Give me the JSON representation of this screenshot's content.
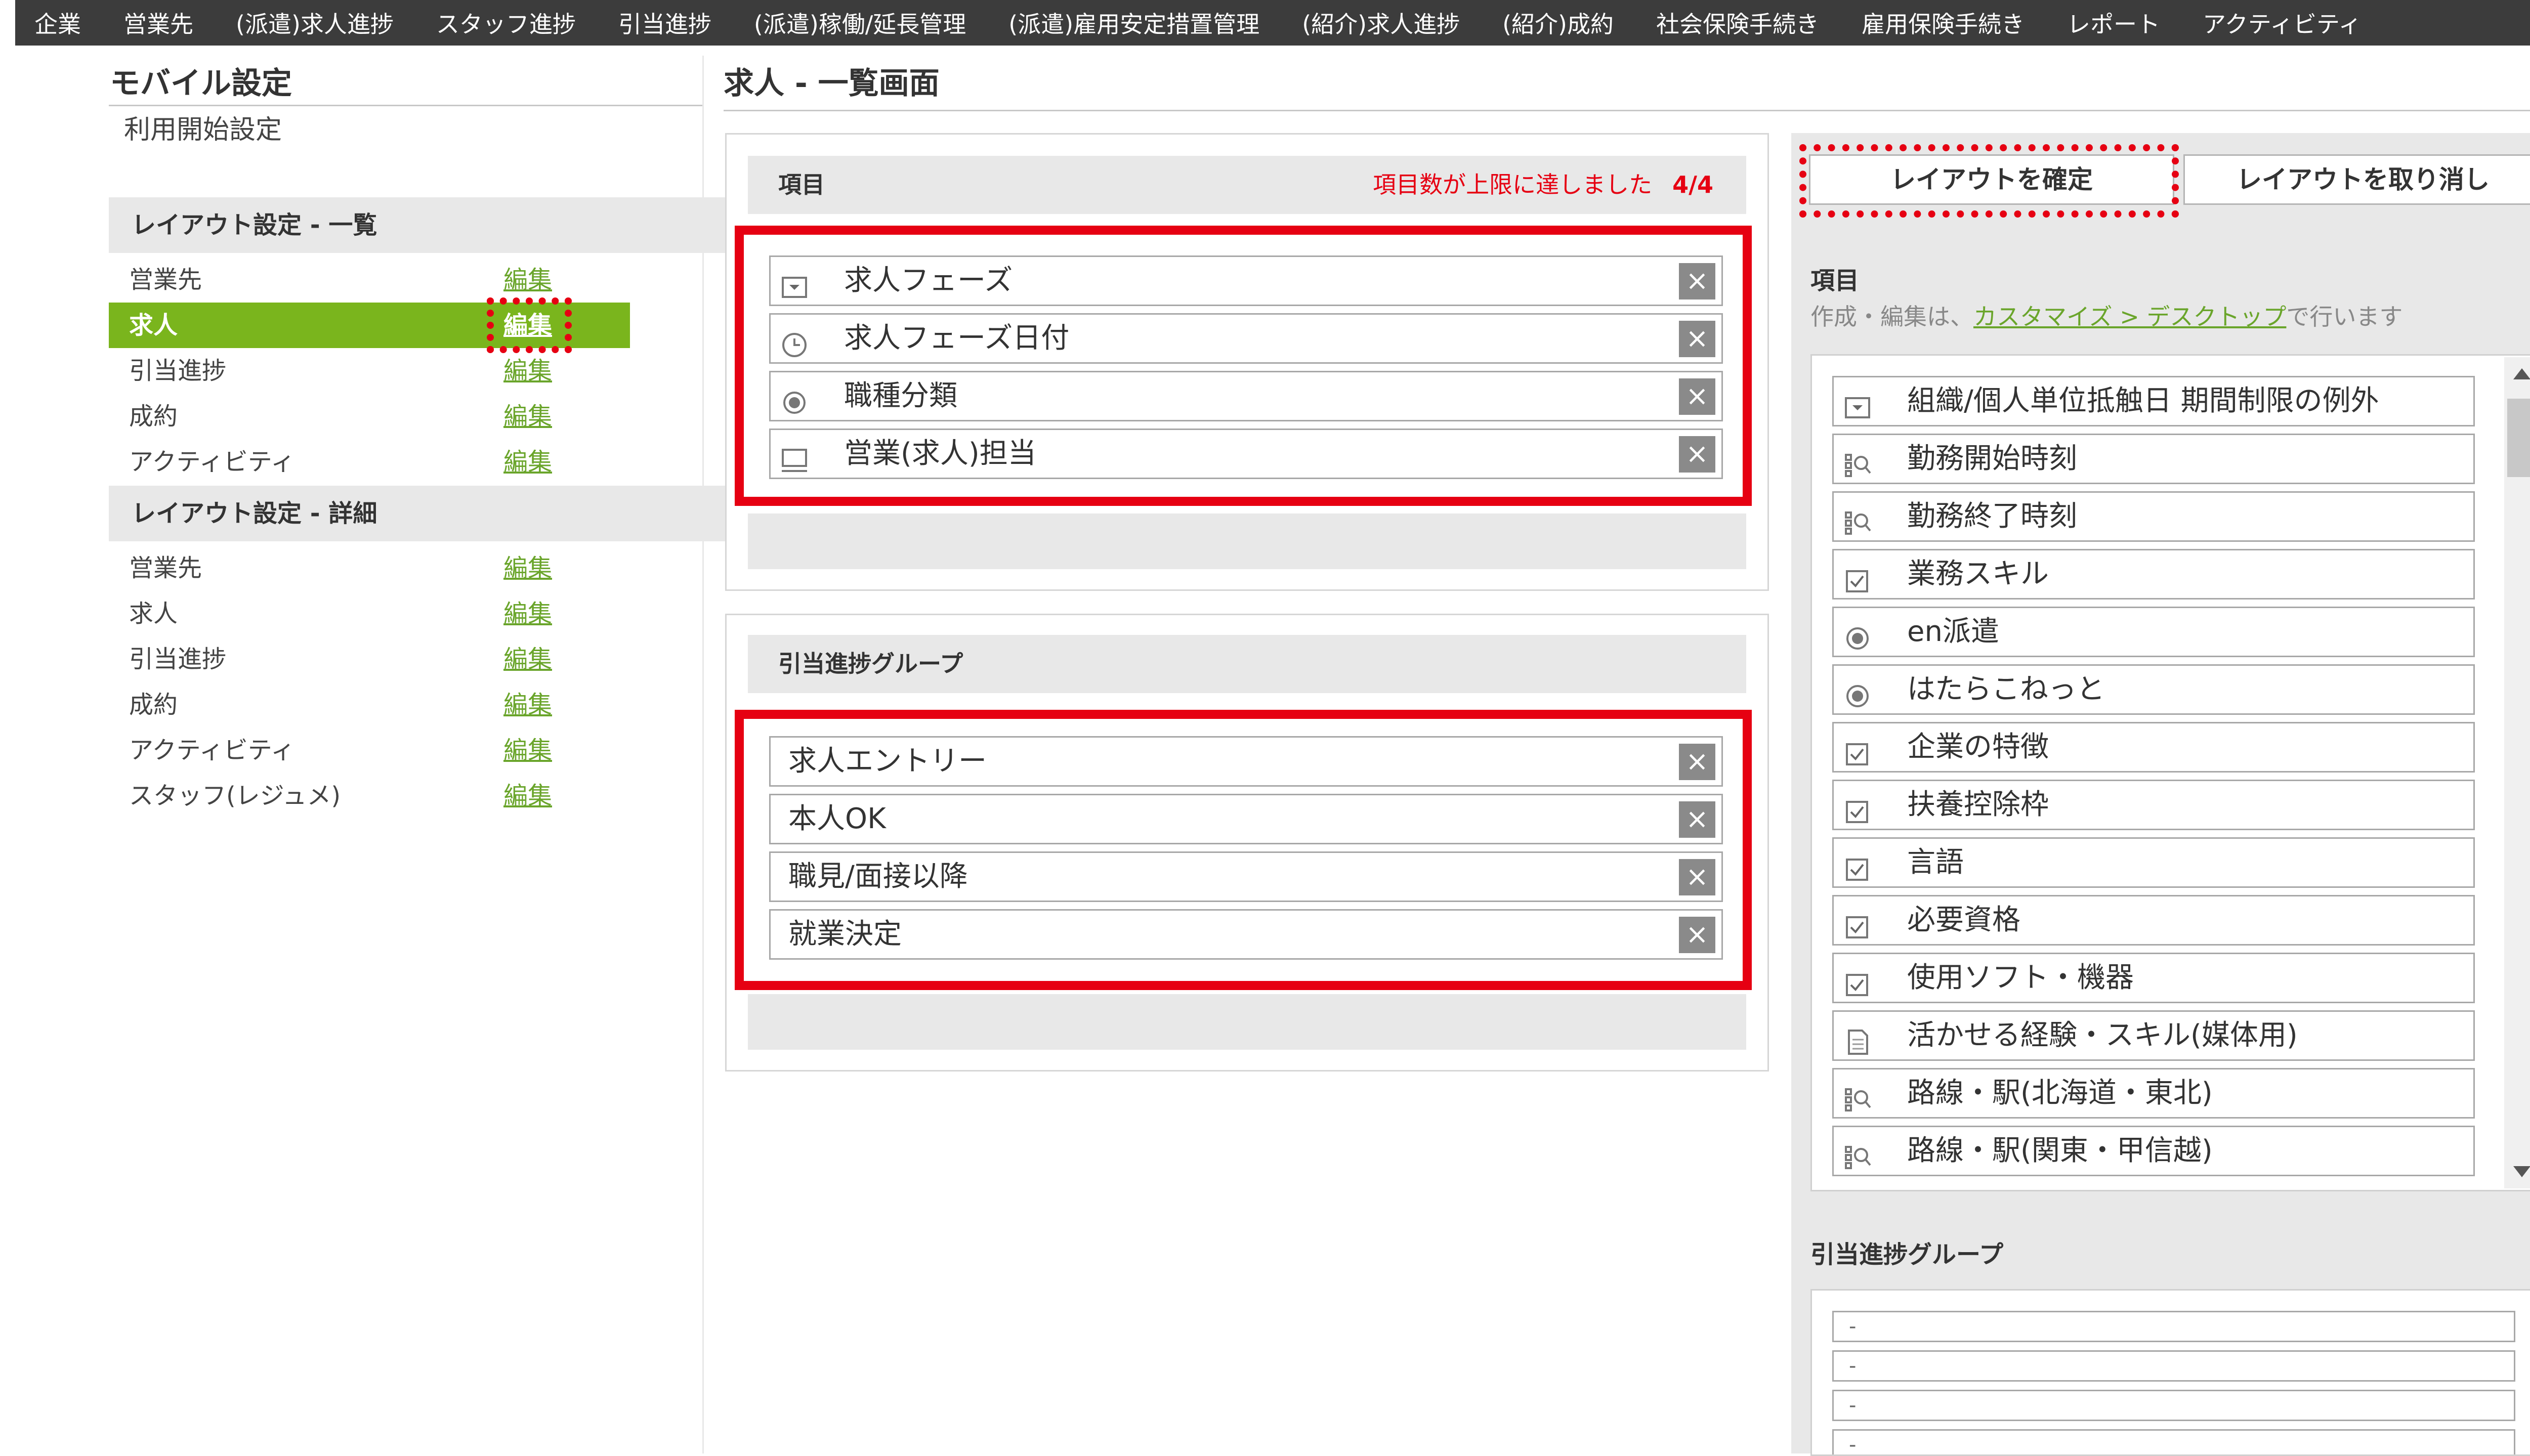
{
  "topnav": [
    "企業",
    "営業先",
    "(派遣)求人進捗",
    "スタッフ進捗",
    "引当進捗",
    "(派遣)稼働/延長管理",
    "(派遣)雇用安定措置管理",
    "(紹介)求人進捗",
    "(紹介)成約",
    "社会保険手続き",
    "雇用保険手続き",
    "レポート",
    "アクティビティ"
  ],
  "sidebar": {
    "title": "モバイル設定",
    "start_link": "利用開始設定",
    "list_section": "レイアウト設定 - 一覧",
    "list_items": [
      {
        "label": "営業先",
        "edit": "編集"
      },
      {
        "label": "求人",
        "edit": "編集"
      },
      {
        "label": "引当進捗",
        "edit": "編集"
      },
      {
        "label": "成約",
        "edit": "編集"
      },
      {
        "label": "アクティビティ",
        "edit": "編集"
      }
    ],
    "detail_section": "レイアウト設定 - 詳細",
    "detail_items": [
      {
        "label": "営業先",
        "edit": "編集"
      },
      {
        "label": "求人",
        "edit": "編集"
      },
      {
        "label": "引当進捗",
        "edit": "編集"
      },
      {
        "label": "成約",
        "edit": "編集"
      },
      {
        "label": "アクティビティ",
        "edit": "編集"
      },
      {
        "label": "スタッフ(レジュメ)",
        "edit": "編集"
      }
    ]
  },
  "main": {
    "title": "求人 - 一覧画面",
    "items_panel": {
      "header": "項目",
      "limit_message": "項目数が上限に達しました",
      "count": "4/4",
      "fields": [
        {
          "label": "求人フェーズ",
          "icon": "dropdown-icon"
        },
        {
          "label": "求人フェーズ日付",
          "icon": "clock-icon"
        },
        {
          "label": "職種分類",
          "icon": "radio-icon"
        },
        {
          "label": "営業(求人)担当",
          "icon": "monitor-icon"
        }
      ]
    },
    "group_panel": {
      "header": "引当進捗グループ",
      "fields": [
        "求人エントリー",
        "本人OK",
        "職見/面接以降",
        "就業決定"
      ]
    },
    "remove_symbol": "×"
  },
  "right": {
    "confirm_button": "レイアウトを確定",
    "cancel_button": "レイアウトを取り消し",
    "items_label": "項目",
    "note_prefix": "作成・編集は、",
    "note_link": "カスタマイズ > デスクトップ",
    "note_suffix": "で行います",
    "available_items": [
      {
        "label": "組織/個人単位抵触日 期間制限の例外",
        "icon": "dropdown-icon"
      },
      {
        "label": "勤務開始時刻",
        "icon": "lookup-icon"
      },
      {
        "label": "勤務終了時刻",
        "icon": "lookup-icon"
      },
      {
        "label": "業務スキル",
        "icon": "checkbox-icon"
      },
      {
        "label": "en派遣",
        "icon": "radio-icon"
      },
      {
        "label": "はたらこねっと",
        "icon": "radio-icon"
      },
      {
        "label": "企業の特徴",
        "icon": "checkbox-icon"
      },
      {
        "label": "扶養控除枠",
        "icon": "checkbox-icon"
      },
      {
        "label": "言語",
        "icon": "checkbox-icon"
      },
      {
        "label": "必要資格",
        "icon": "checkbox-icon"
      },
      {
        "label": "使用ソフト・機器",
        "icon": "checkbox-icon"
      },
      {
        "label": "活かせる経験・スキル(媒体用)",
        "icon": "document-icon"
      },
      {
        "label": "路線・駅(北海道・東北)",
        "icon": "lookup-icon"
      },
      {
        "label": "路線・駅(関東・甲信越)",
        "icon": "lookup-icon"
      }
    ],
    "group_label": "引当進捗グループ",
    "group_items": [
      "-",
      "-",
      "-",
      "-"
    ]
  }
}
